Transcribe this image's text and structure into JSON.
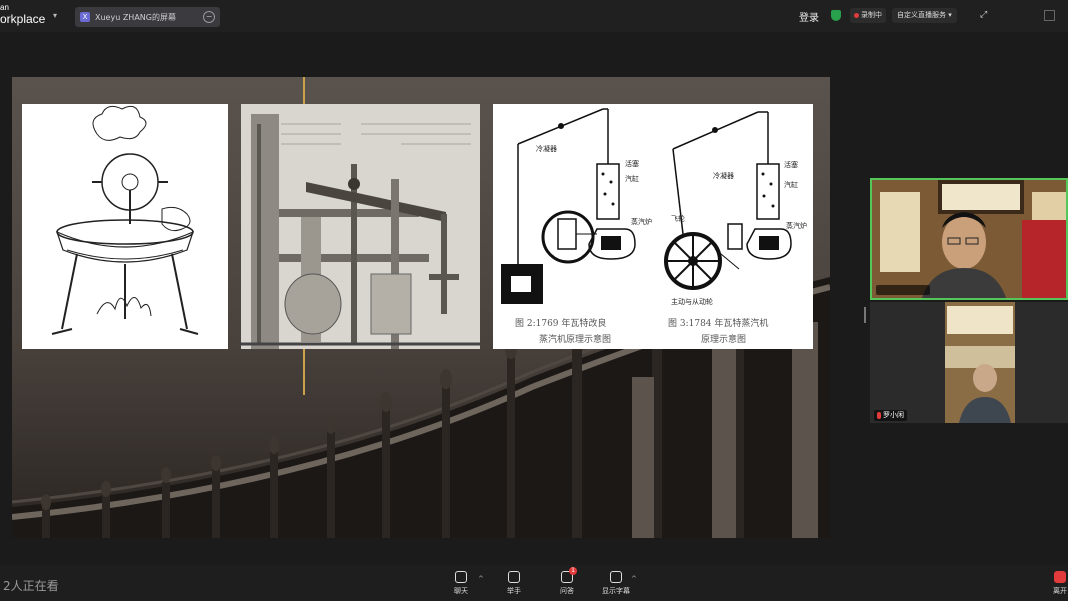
{
  "app": {
    "logo_line1": "an",
    "logo_line2": "orkplace"
  },
  "share": {
    "avatar": "X",
    "title": "Xueyu ZHANG的屏幕"
  },
  "header": {
    "login": "登录",
    "recording": "录制中",
    "live": "自定义直播服务"
  },
  "slide": {
    "fig2_caption_1": "图 2:1769 年瓦特改良",
    "fig2_caption_2": "蒸汽机原理示意图",
    "fig3_caption_1": "图 3:1784 年瓦特蒸汽机",
    "fig3_caption_2": "原理示意图",
    "labels": {
      "condenser_a": "冷凝器",
      "piston_a": "活塞",
      "cylinder_a": "汽缸",
      "boiler_a": "蒸汽炉",
      "condenser_b": "冷凝器",
      "piston_b": "活塞",
      "cylinder_b": "汽缸",
      "boiler_b": "蒸汽炉",
      "flywheel": "飞轮",
      "gears": "主动与从动轮"
    }
  },
  "participants": [
    {
      "name": ""
    },
    {
      "name": "罗小闲"
    }
  ],
  "footer": {
    "viewers": "2人正在看",
    "chat": "聊天",
    "raise_hand": "举手",
    "qa": "问答",
    "qa_badge": "1",
    "captions": "显示字幕",
    "fullscreen": "离开"
  },
  "colors": {
    "active_speaker_border": "#55c65a",
    "recording_dot": "#e23b3b",
    "accent_line": "#c9a24a"
  }
}
